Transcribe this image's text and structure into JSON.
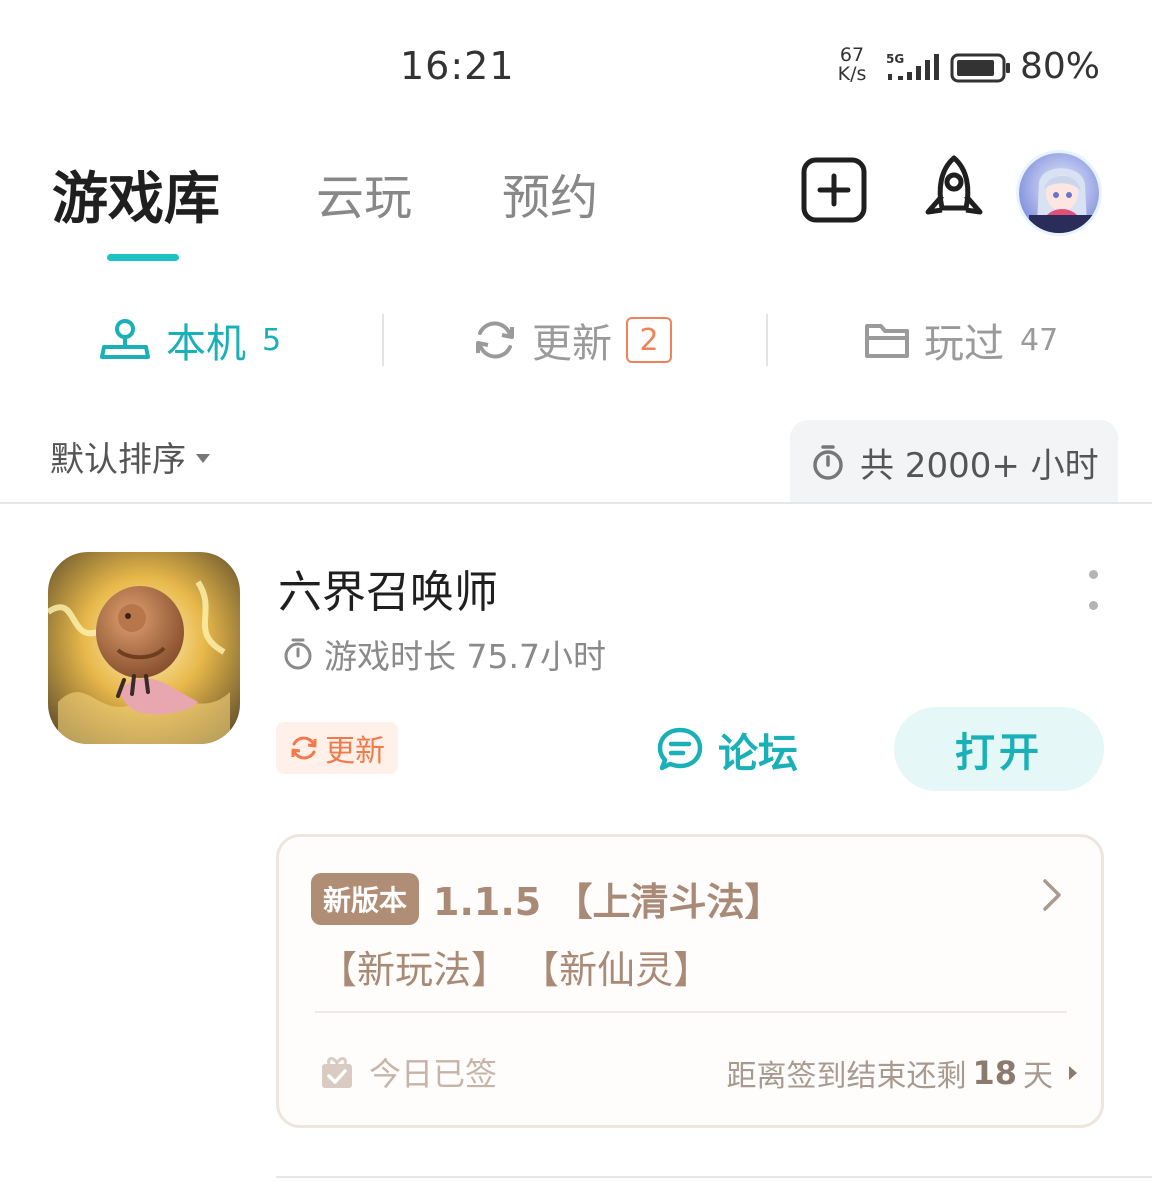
{
  "status_bar": {
    "time": "16:21",
    "net_speed_value": "67",
    "net_speed_unit": "K/s",
    "network": "5G",
    "battery": "80%"
  },
  "top_tabs": [
    {
      "label": "游戏库",
      "active": true
    },
    {
      "label": "云玩",
      "active": false
    },
    {
      "label": "预约",
      "active": false
    }
  ],
  "header_icons": [
    "add-icon",
    "rocket-icon",
    "avatar"
  ],
  "sub_tabs": [
    {
      "label": "本机",
      "count": "5",
      "icon": "joystick-icon"
    },
    {
      "label": "更新",
      "count": "2",
      "icon": "refresh-icon"
    },
    {
      "label": "玩过",
      "count": "47",
      "icon": "folder-icon"
    }
  ],
  "sort": {
    "label": "默认排序"
  },
  "total_hours": "共 2000+ 小时",
  "game": {
    "title": "六界召唤师",
    "play_time": "游戏时长 75.7小时",
    "update_tag": "更新",
    "forum_label": "论坛",
    "open_label": "打开",
    "version_card": {
      "badge": "新版本",
      "title": "1.1.5 【上清斗法】",
      "line2": "【新玩法】 【新仙灵】",
      "signin_status": "今日已签",
      "countdown_prefix": "距离签到结束还剩",
      "countdown_days": "18",
      "countdown_suffix": "天"
    }
  },
  "colors": {
    "accent": "#1ab0b8",
    "update": "#f07a4a",
    "version_brown": "#b08d75"
  }
}
